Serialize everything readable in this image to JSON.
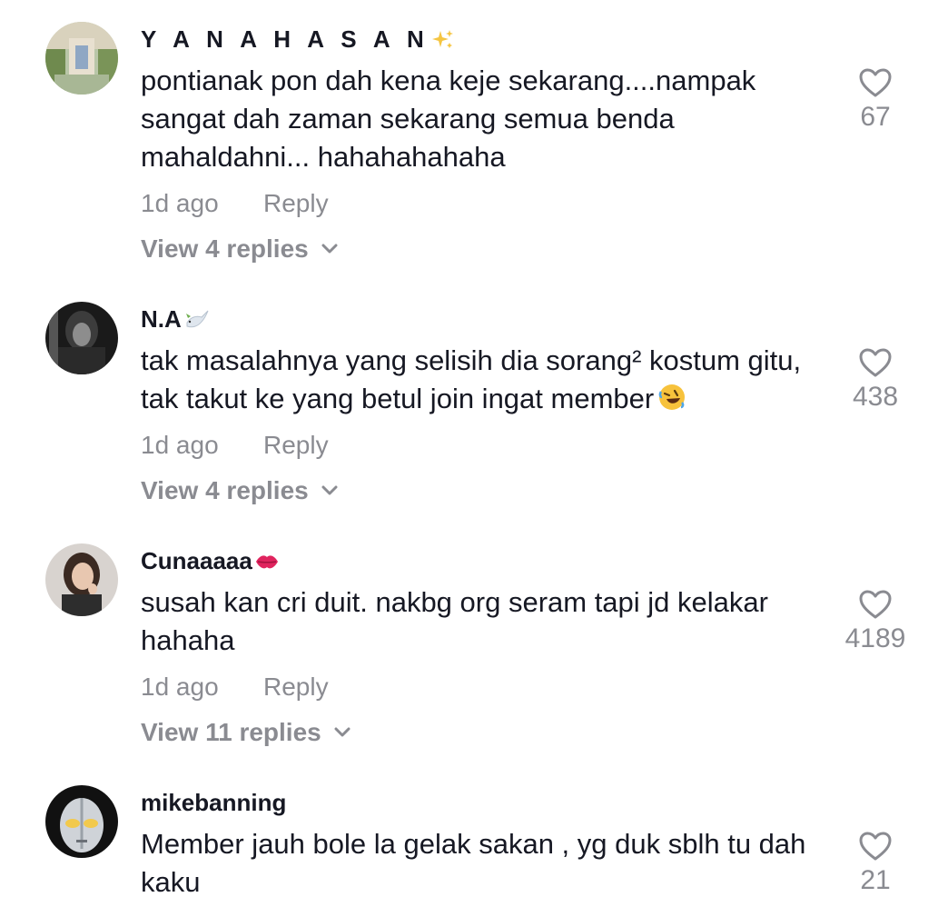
{
  "comments": [
    {
      "username": "Y A N A H A S A N",
      "username_emoji": "sparkles",
      "text": "pontianak pon dah kena keje sekarang....nampak sangat dah zaman sekarang semua benda mahaldahni... hahahahahaha",
      "time": "1d ago",
      "reply_label": "Reply",
      "view_replies": "View 4 replies",
      "likes": "67"
    },
    {
      "username": "N.A",
      "username_emoji": "dove",
      "text": "tak masalahnya yang selisih dia sorang² kostum gitu, tak takut ke yang betul join ingat member",
      "text_emoji": "rolling-on-floor-laughing",
      "time": "1d ago",
      "reply_label": "Reply",
      "view_replies": "View 4 replies",
      "likes": "438"
    },
    {
      "username": "Cunaaaaa",
      "username_emoji": "kiss-mark",
      "text": "susah kan cri duit. nakbg org seram tapi jd kelakar hahaha",
      "time": "1d ago",
      "reply_label": "Reply",
      "view_replies": "View 11 replies",
      "likes": "4189"
    },
    {
      "username": "mikebanning",
      "text": "Member jauh bole la gelak sakan , yg duk sblh tu dah kaku",
      "likes": "21"
    }
  ],
  "colors": {
    "primary_text": "#161823",
    "secondary_text": "#8a8b91"
  }
}
